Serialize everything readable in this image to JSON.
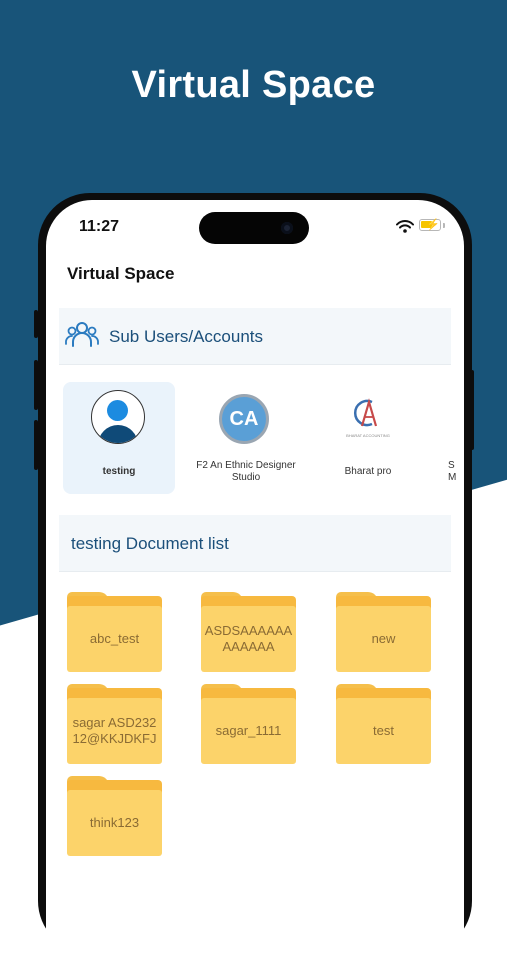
{
  "headline": "Virtual Space",
  "status_bar": {
    "time": "11:27",
    "icons": [
      "wifi-icon",
      "battery-charging-icon"
    ]
  },
  "app": {
    "title": "Virtual Space",
    "sub_users_label": "Sub Users/Accounts",
    "accounts": [
      {
        "name": "testing",
        "icon": "user-avatar-icon",
        "selected": true
      },
      {
        "name": "F2 An Ethnic Designer Studio",
        "logo_text": "CA"
      },
      {
        "name": "Bharat pro",
        "logo_text": "C A",
        "logo_subtext": "BHARAT ACCOUNTING"
      },
      {
        "name": "S M"
      }
    ],
    "document_list_label": "testing Document list",
    "folders": [
      "abc_test",
      "ASDSAAAAAAAAAAAA",
      "new",
      "sagar ASD23212@KKJDKFJ",
      "sagar_1111",
      "test",
      "think123"
    ]
  },
  "colors": {
    "brand_blue": "#185479",
    "link_blue": "#1b4f7a",
    "folder_yellow": "#fcd36a",
    "selected_bg": "#eaf3fb"
  }
}
